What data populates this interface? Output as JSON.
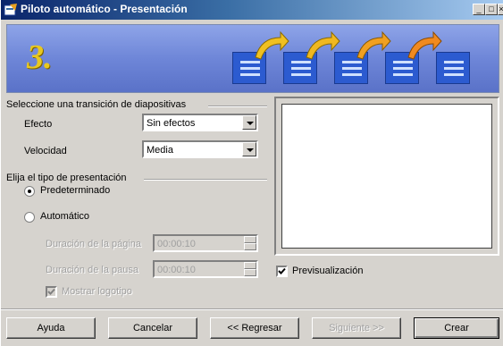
{
  "window": {
    "title": "Piloto automático - Presentación"
  },
  "banner": {
    "step_number": "3."
  },
  "transition_group": {
    "label": "Seleccione una transición de diapositivas",
    "effect_label": "Efecto",
    "effect_value": "Sin efectos",
    "speed_label": "Velocidad",
    "speed_value": "Media"
  },
  "presentation_group": {
    "label": "Elija el tipo de presentación",
    "option_default": "Predeterminado",
    "option_automatic": "Automático",
    "selected": "Predeterminado",
    "page_duration_label": "Duración de la página",
    "page_duration_value": "00:00:10",
    "pause_duration_label": "Duración de la pausa",
    "pause_duration_value": "00:00:10",
    "show_logo_label": "Mostrar logotipo",
    "show_logo_checked": true
  },
  "preview": {
    "checkbox_label": "Previsualización",
    "checked": true
  },
  "buttons": {
    "help": "Ayuda",
    "cancel": "Cancelar",
    "back": "<< Regresar",
    "next": "Siguiente >>",
    "create": "Crear"
  },
  "colors": {
    "title_start": "#0a246a",
    "title_end": "#a6caf0",
    "dialog_bg": "#d6d3ce",
    "banner_blue": "#6e86d8",
    "step_yellow": "#e8c820"
  }
}
